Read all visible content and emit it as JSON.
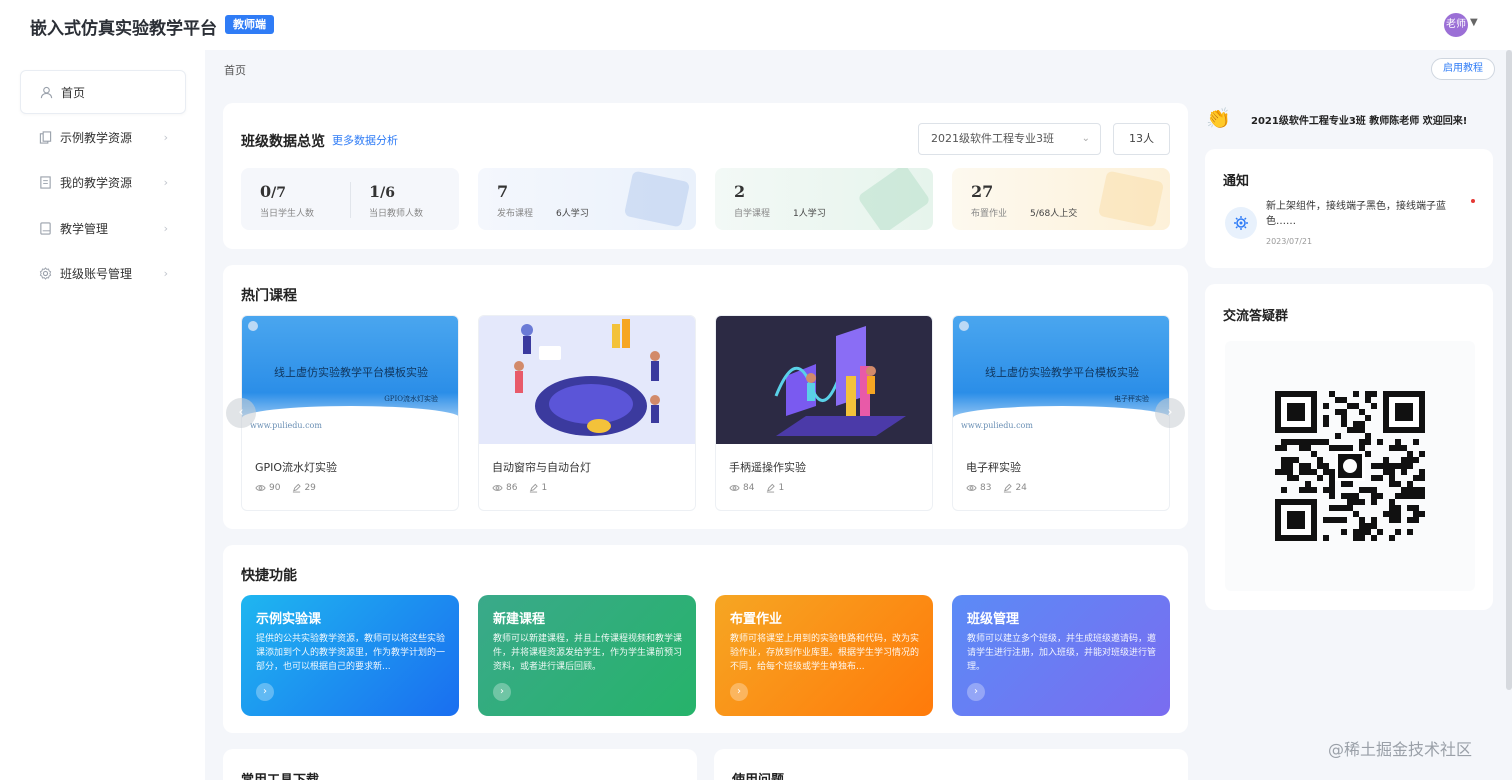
{
  "header": {
    "app_title": "嵌入式仿真实验教学平台",
    "role_badge": "教师端",
    "avatar_text": "老师"
  },
  "sidebar": {
    "items": [
      {
        "label": "首页",
        "icon": "user-icon"
      },
      {
        "label": "示例教学资源",
        "icon": "copy-icon"
      },
      {
        "label": "我的教学资源",
        "icon": "document-icon"
      },
      {
        "label": "教学管理",
        "icon": "book-icon"
      },
      {
        "label": "班级账号管理",
        "icon": "gear-icon"
      }
    ]
  },
  "breadcrumb": "首页",
  "tutorial_button": "启用教程",
  "overview": {
    "title": "班级数据总览",
    "more_link": "更多数据分析",
    "class_select": "2021级软件工程专业3班",
    "class_count": "13人",
    "stats": [
      {
        "num": "0",
        "den": "/7",
        "label": "当日学生人数"
      },
      {
        "num": "1",
        "den": "/6",
        "label": "当日教师人数"
      },
      {
        "num": "7",
        "label": "发布课程",
        "sub": "6人学习"
      },
      {
        "num": "2",
        "label": "自学课程",
        "sub": "1人学习"
      },
      {
        "num": "27",
        "label": "布置作业",
        "sub": "5/68人上交"
      }
    ]
  },
  "hot_courses": {
    "title": "热门课程",
    "courses": [
      {
        "name": "GPIO流水灯实验",
        "views": "90",
        "edits": "29",
        "thumb_title": "线上虚仿实验教学平台模板实验",
        "thumb_sub": "GPIO流水灯实验",
        "thumb_url": "www.puliedu.com"
      },
      {
        "name": "自动窗帘与自动台灯",
        "views": "86",
        "edits": "1"
      },
      {
        "name": "手柄遥操作实验",
        "views": "84",
        "edits": "1"
      },
      {
        "name": "电子秤实验",
        "views": "83",
        "edits": "24",
        "thumb_title": "线上虚仿实验教学平台模板实验",
        "thumb_sub": "电子秤实验",
        "thumb_url": "www.puliedu.com"
      }
    ]
  },
  "quick": {
    "title": "快捷功能",
    "items": [
      {
        "title": "示例实验课",
        "desc": "提供的公共实验教学资源，教师可以将这些实验课添加到个人的教学资源里，作为教学计划的一部分，也可以根据自己的要求新...",
        "color_from": "#1fb6f0",
        "color_to": "#1a6ef0"
      },
      {
        "title": "新建课程",
        "desc": "教师可以新建课程，并且上传课程视频和教学课件，并将课程资源发给学生，作为学生课前预习资料，或者进行课后回顾。",
        "color_from": "#3aa98a",
        "color_to": "#26b36a"
      },
      {
        "title": "布置作业",
        "desc": "教师可将课堂上用到的实验电路和代码，改为实验作业，存放到作业库里。根据学生学习情况的不同，给每个班级或学生单独布...",
        "color_from": "#f6a623",
        "color_to": "#ff7a0a"
      },
      {
        "title": "班级管理",
        "desc": "教师可以建立多个班级，并生成班级邀请码，邀请学生进行注册，加入班级，并能对班级进行管理。",
        "color_from": "#5b8bf6",
        "color_to": "#7a6cf0"
      }
    ]
  },
  "bottom": {
    "tools_title": "常用工具下载",
    "faq_title": "使用问题"
  },
  "welcome": "2021级软件工程专业3班  教师陈老师  欢迎回来!",
  "notice": {
    "title": "通知",
    "text": "新上架组件，接线端子黑色，接线端子蓝色……",
    "date": "2023/07/21"
  },
  "qa": {
    "title": "交流答疑群"
  },
  "watermark": "@稀土掘金技术社区"
}
